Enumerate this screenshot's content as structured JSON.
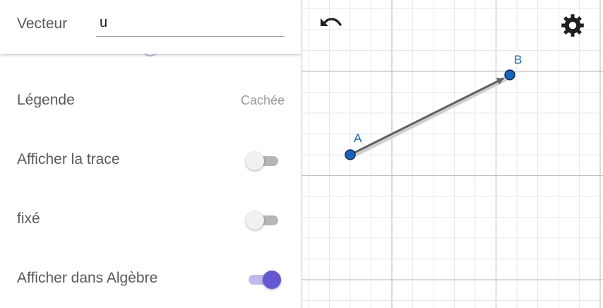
{
  "object_properties": {
    "name_label": "Vecteur",
    "name_value": "u",
    "rows": [
      {
        "label": "Légende",
        "value": "Cachée"
      },
      {
        "label": "Afficher la trace",
        "toggle": false
      },
      {
        "label": "fixé",
        "toggle": false
      },
      {
        "label": "Afficher dans Algèbre",
        "toggle": true
      }
    ]
  },
  "graphics": {
    "toolbar": {
      "undo_icon": "undo-icon",
      "settings_icon": "gear-icon"
    },
    "points": [
      {
        "name": "A",
        "color": "#1565c0"
      },
      {
        "name": "B",
        "color": "#1565c0"
      }
    ],
    "vector": {
      "from": "A",
      "to": "B",
      "color": "#616161"
    }
  },
  "colors": {
    "accent": "#6557d2",
    "accent_light": "#c0b9f0",
    "point_fill": "#1565c0"
  }
}
